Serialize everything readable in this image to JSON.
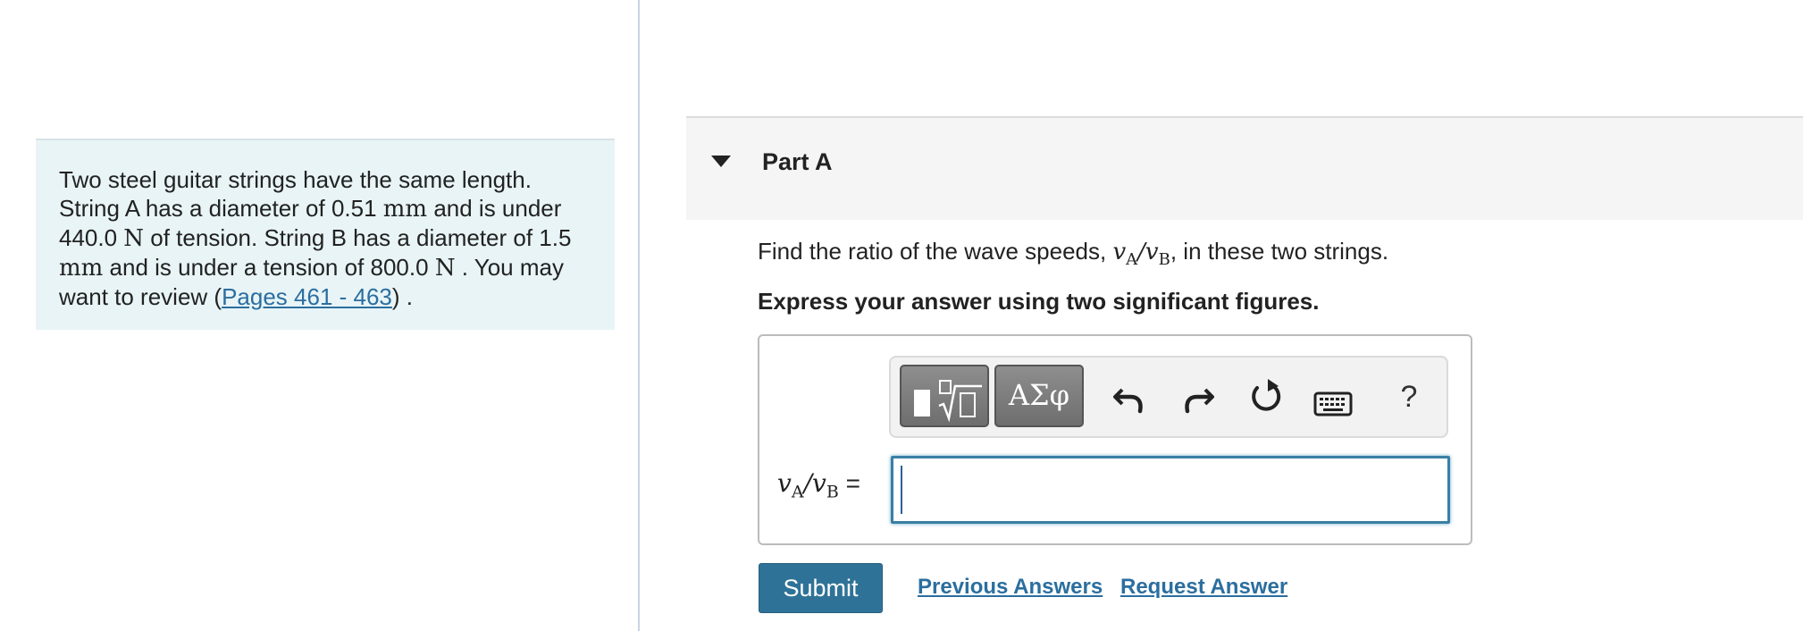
{
  "problem": {
    "s1": "Two steel guitar strings have the same length. String A has a diameter of 0.51 ",
    "u1": "mm",
    "s2": " and is under 440.0 ",
    "u2": "N",
    "s3": " of tension. String B has a diameter of 1.5 ",
    "u3": "mm",
    "s4": " and is under a tension of 800.0 ",
    "u4": "N",
    "s5": " . You may want to review (",
    "link": "Pages 461 - 463",
    "s6": ") ."
  },
  "part": {
    "title": "Part A",
    "caret_icon": "triangle-down-icon"
  },
  "question": {
    "prefix": "Find the ratio of the wave speeds, ",
    "math": "vA/vB",
    "suffix": ", in these two strings."
  },
  "instruction": "Express your answer using two significant figures.",
  "toolbar": {
    "templates_icon": "templates-icon",
    "greek_label": "ΑΣφ",
    "undo_icon": "undo-icon",
    "redo_icon": "redo-icon",
    "reset_icon": "reset-icon",
    "keyboard_icon": "keyboard-icon",
    "help_label": "?"
  },
  "answer": {
    "label": "vA/vB =",
    "value": ""
  },
  "actions": {
    "submit": "Submit",
    "previous_answers": "Previous Answers",
    "request_answer": "Request Answer"
  },
  "colors": {
    "accent": "#2f7297",
    "link": "#2b6e9f",
    "problem_bg": "#e8f4f6",
    "input_border": "#3a7fa5"
  }
}
